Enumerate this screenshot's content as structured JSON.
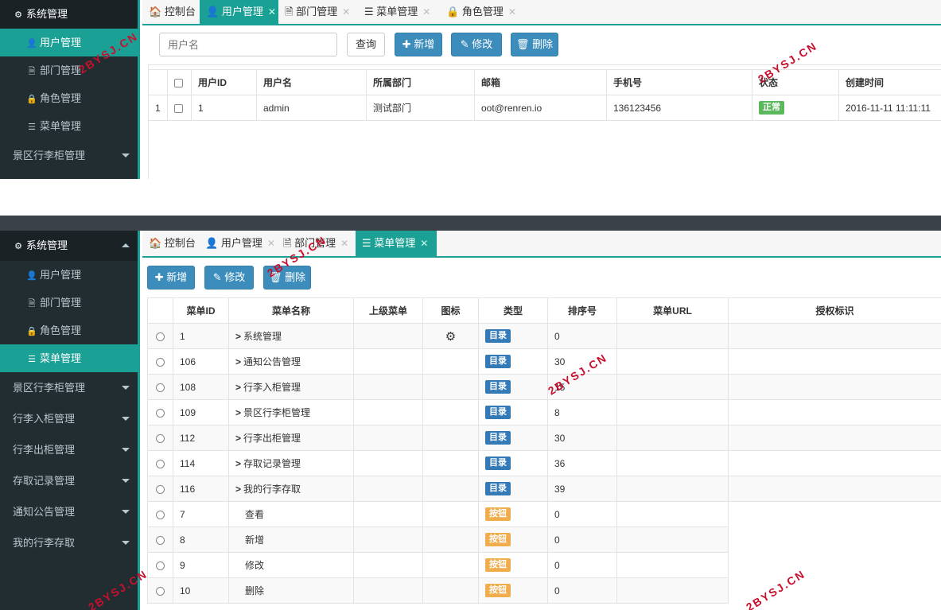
{
  "panel1": {
    "sidebar": {
      "header": "系统管理",
      "items": [
        {
          "label": "用户管理",
          "icon": "user-icon",
          "active": true
        },
        {
          "label": "部门管理",
          "icon": "file-icon",
          "active": false
        },
        {
          "label": "角色管理",
          "icon": "lock-icon",
          "active": false
        },
        {
          "label": "菜单管理",
          "icon": "list-icon",
          "active": false
        }
      ],
      "groups": [
        "景区行李柜管理"
      ]
    },
    "tabs": [
      {
        "label": "控制台",
        "icon": "home-icon",
        "active": false
      },
      {
        "label": "用户管理",
        "icon": "user-icon",
        "active": true
      },
      {
        "label": "部门管理",
        "icon": "file-icon",
        "active": false
      },
      {
        "label": "菜单管理",
        "icon": "list-icon",
        "active": false
      },
      {
        "label": "角色管理",
        "icon": "lock-icon",
        "active": false
      }
    ],
    "toolbar": {
      "search_placeholder": "用户名",
      "query_label": "查询",
      "add_label": "新增",
      "edit_label": "修改",
      "delete_label": "删除"
    },
    "table": {
      "headers": [
        "用户ID",
        "用户名",
        "所属部门",
        "邮箱",
        "手机号",
        "状态",
        "创建时间"
      ],
      "rows": [
        {
          "index": "1",
          "id": "1",
          "username": "admin",
          "dept": "测试部门",
          "email": "oot@renren.io",
          "mobile": "136123456",
          "status": "正常",
          "created": "2016-11-11 11:11:11"
        }
      ]
    }
  },
  "panel2": {
    "sidebar": {
      "header": "系统管理",
      "items": [
        {
          "label": "用户管理",
          "icon": "user-icon",
          "active": false
        },
        {
          "label": "部门管理",
          "icon": "file-icon",
          "active": false
        },
        {
          "label": "角色管理",
          "icon": "lock-icon",
          "active": false
        },
        {
          "label": "菜单管理",
          "icon": "list-icon",
          "active": true
        }
      ],
      "groups": [
        "景区行李柜管理",
        "行李入柜管理",
        "行李出柜管理",
        "存取记录管理",
        "通知公告管理",
        "我的行李存取"
      ]
    },
    "tabs": [
      {
        "label": "控制台",
        "icon": "home-icon",
        "active": false
      },
      {
        "label": "用户管理",
        "icon": "user-icon",
        "active": false
      },
      {
        "label": "部门管理",
        "icon": "file-icon",
        "active": false
      },
      {
        "label": "菜单管理",
        "icon": "list-icon",
        "active": true
      }
    ],
    "toolbar": {
      "add_label": "新增",
      "edit_label": "修改",
      "delete_label": "删除"
    },
    "table": {
      "headers": [
        "菜单ID",
        "菜单名称",
        "上级菜单",
        "图标",
        "类型",
        "排序号",
        "菜单URL",
        "授权标识"
      ],
      "rows": [
        {
          "id": "1",
          "name": "系统管理",
          "parent": "",
          "icon": "gear-icon",
          "type": "目录",
          "type_color": "#337ab7",
          "order": "0",
          "url": "",
          "perms": "",
          "dir": true
        },
        {
          "id": "106",
          "name": "通知公告管理",
          "parent": "",
          "icon": "",
          "type": "目录",
          "type_color": "#337ab7",
          "order": "30",
          "url": "",
          "perms": "",
          "dir": true
        },
        {
          "id": "108",
          "name": "行李入柜管理",
          "parent": "",
          "icon": "",
          "type": "目录",
          "type_color": "#337ab7",
          "order": "15",
          "url": "",
          "perms": "",
          "dir": true
        },
        {
          "id": "109",
          "name": "景区行李柜管理",
          "parent": "",
          "icon": "",
          "type": "目录",
          "type_color": "#337ab7",
          "order": "8",
          "url": "",
          "perms": "",
          "dir": true
        },
        {
          "id": "112",
          "name": "行李出柜管理",
          "parent": "",
          "icon": "",
          "type": "目录",
          "type_color": "#337ab7",
          "order": "30",
          "url": "",
          "perms": "",
          "dir": true
        },
        {
          "id": "114",
          "name": "存取记录管理",
          "parent": "",
          "icon": "",
          "type": "目录",
          "type_color": "#337ab7",
          "order": "36",
          "url": "",
          "perms": "",
          "dir": true
        },
        {
          "id": "116",
          "name": "我的行李存取",
          "parent": "",
          "icon": "",
          "type": "目录",
          "type_color": "#337ab7",
          "order": "39",
          "url": "",
          "perms": "",
          "dir": true
        },
        {
          "id": "7",
          "name": "查看",
          "parent": "",
          "icon": "",
          "type": "按钮",
          "type_color": "#f0ad4e",
          "order": "0",
          "url": "",
          "perms": "",
          "dir": false
        },
        {
          "id": "8",
          "name": "新增",
          "parent": "",
          "icon": "",
          "type": "按钮",
          "type_color": "#f0ad4e",
          "order": "0",
          "url": "",
          "perms": "",
          "dir": false
        },
        {
          "id": "9",
          "name": "修改",
          "parent": "",
          "icon": "",
          "type": "按钮",
          "type_color": "#f0ad4e",
          "order": "0",
          "url": "",
          "perms": "",
          "dir": false
        },
        {
          "id": "10",
          "name": "删除",
          "parent": "",
          "icon": "",
          "type": "按钮",
          "type_color": "#f0ad4e",
          "order": "0",
          "url": "",
          "perms": "",
          "dir": false
        }
      ]
    }
  },
  "watermark": "2BYSJ.CN",
  "colors": {
    "accent": "#1aa094",
    "sidebar_bg": "#222d32",
    "primary": "#3c8dbc",
    "success": "#5cb85c",
    "warning": "#f0ad4e"
  }
}
